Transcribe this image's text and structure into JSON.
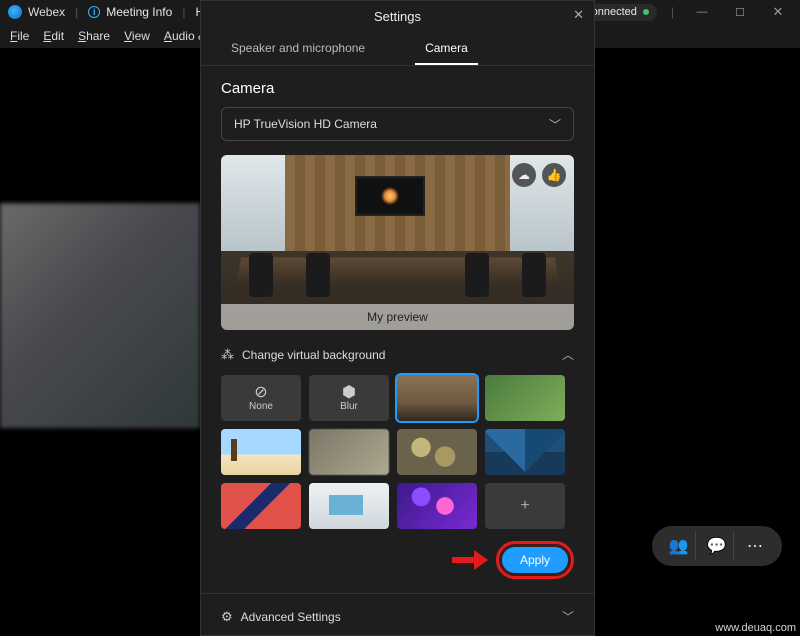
{
  "titlebar": {
    "brand": "Webex",
    "meeting_info": "Meeting Info",
    "more": "H",
    "connected": "Connected"
  },
  "menubar": {
    "file": "File",
    "edit": "Edit",
    "share": "Share",
    "view": "View",
    "audio": "Audio & V"
  },
  "settings": {
    "title": "Settings",
    "tabs": {
      "speaker": "Speaker and microphone",
      "camera": "Camera"
    },
    "camera_section": "Camera",
    "camera_select": "HP TrueVision HD Camera",
    "preview_caption": "My preview",
    "vbg_title": "Change virtual background",
    "tiles": {
      "none": "None",
      "blur": "Blur",
      "add": "+"
    },
    "apply": "Apply",
    "advanced": "Advanced Settings"
  },
  "watermark": "www.deuaq.com"
}
